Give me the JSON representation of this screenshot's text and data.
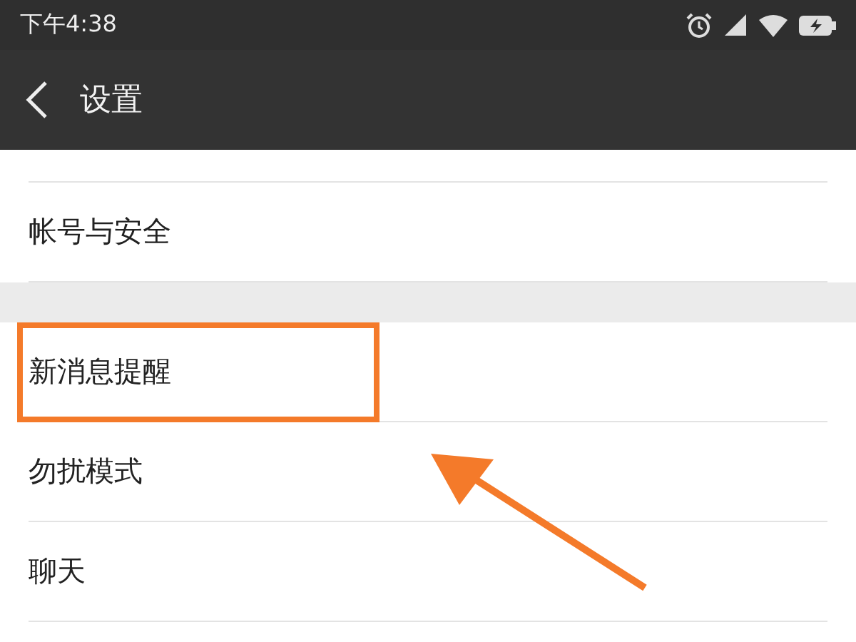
{
  "status_bar": {
    "time": "下午4:38"
  },
  "header": {
    "title": "设置"
  },
  "groups": [
    {
      "items": [
        {
          "label": "帐号与安全",
          "highlighted": false
        }
      ]
    },
    {
      "items": [
        {
          "label": "新消息提醒",
          "highlighted": true
        },
        {
          "label": "勿扰模式",
          "highlighted": false
        },
        {
          "label": "聊天",
          "highlighted": false
        }
      ]
    }
  ]
}
